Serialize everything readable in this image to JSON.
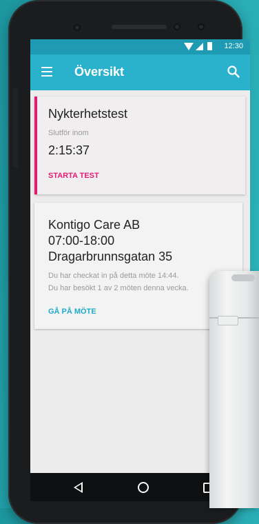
{
  "status_bar": {
    "time": "12:30"
  },
  "app_bar": {
    "title": "Översikt"
  },
  "test_card": {
    "title": "Nykterhetstest",
    "subtitle": "Slutför inom",
    "timer": "2:15:37",
    "action": "STARTA TEST",
    "accent_color": "#e41a73"
  },
  "meeting_card": {
    "organization": "Kontigo Care AB",
    "hours": "07:00-18:00",
    "address": "Dragarbrunnsgatan 35",
    "note_checkin": "Du har checkat in på detta möte 14:44.",
    "note_visits": "Du har besökt 1 av 2 möten denna vecka.",
    "action": "GÅ PÅ MÖTE",
    "accent_color": "#1eaacb"
  },
  "icons": {
    "menu": "menu-icon",
    "search": "search-icon",
    "wifi": "wifi-icon",
    "signal": "signal-icon",
    "battery": "battery-icon",
    "back": "back-icon",
    "home": "home-icon",
    "recent": "recent-apps-icon"
  },
  "colors": {
    "app_bar": "#2ab1cc",
    "background": "#27a8b0"
  }
}
